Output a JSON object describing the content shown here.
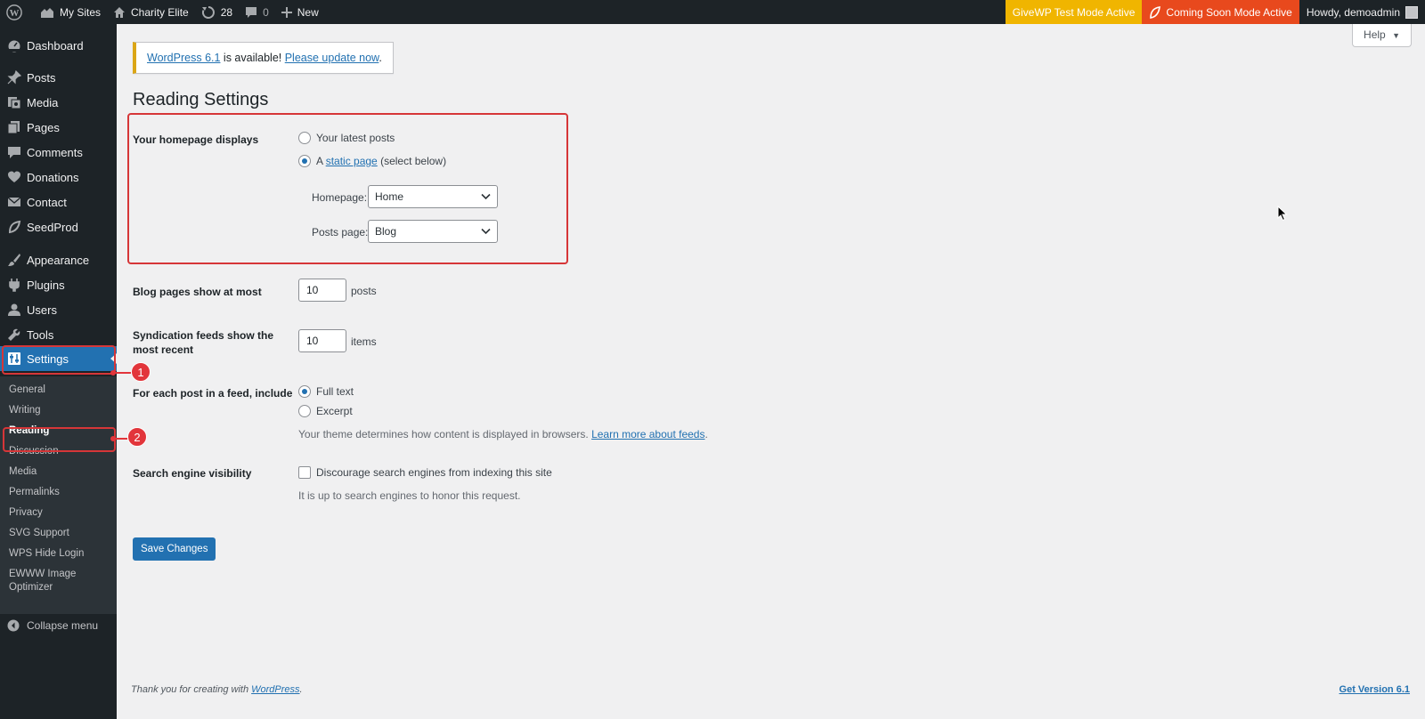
{
  "admin_bar": {
    "my_sites": "My Sites",
    "site_name": "Charity Elite",
    "updates_count": "28",
    "comments_count": "0",
    "new_label": "New",
    "givewp_notice": "GiveWP Test Mode Active",
    "coming_soon_notice": "Coming Soon Mode Active",
    "howdy": "Howdy, demoadmin",
    "colors": {
      "givewp": "#f0b500",
      "coming_soon": "#e8491d"
    }
  },
  "sidebar": {
    "items": [
      {
        "label": "Dashboard",
        "icon": "dashboard-icon"
      },
      {
        "label": "Posts",
        "icon": "pin-icon"
      },
      {
        "label": "Media",
        "icon": "media-icon"
      },
      {
        "label": "Pages",
        "icon": "pages-icon"
      },
      {
        "label": "Comments",
        "icon": "comment-icon"
      },
      {
        "label": "Donations",
        "icon": "heart-icon"
      },
      {
        "label": "Contact",
        "icon": "mail-icon"
      },
      {
        "label": "SeedProd",
        "icon": "seedprod-icon"
      },
      {
        "label": "Appearance",
        "icon": "brush-icon"
      },
      {
        "label": "Plugins",
        "icon": "plugin-icon"
      },
      {
        "label": "Users",
        "icon": "user-icon"
      },
      {
        "label": "Tools",
        "icon": "wrench-icon"
      },
      {
        "label": "Settings",
        "icon": "settings-icon"
      }
    ],
    "submenu": [
      "General",
      "Writing",
      "Reading",
      "Discussion",
      "Media",
      "Permalinks",
      "Privacy",
      "SVG Support",
      "WPS Hide Login",
      "EWWW Image",
      "Optimizer"
    ],
    "collapse": "Collapse menu",
    "active_submenu": "Reading"
  },
  "annotations": {
    "badge_1": "1",
    "badge_2": "2"
  },
  "help": "Help",
  "notice": {
    "link1": "WordPress 6.1",
    "text": " is available! ",
    "link2": "Please update now",
    "end": "."
  },
  "page_title": "Reading Settings",
  "homepage_displays": {
    "label": "Your homepage displays",
    "option_latest": "Your latest posts",
    "option_static_prefix": "A ",
    "option_static_link": "static page",
    "option_static_suffix": " (select below)",
    "selected": "static",
    "homepage_label": "Homepage:",
    "homepage_value": "Home",
    "posts_page_label": "Posts page:",
    "posts_page_value": "Blog"
  },
  "blog_pages": {
    "label": "Blog pages show at most",
    "value": "10",
    "unit": "posts"
  },
  "syndication": {
    "label_line1": "Syndication feeds show the",
    "label_line2": "most recent",
    "value": "10",
    "unit": "items"
  },
  "feed_include": {
    "label": "For each post in a feed, include",
    "option_full": "Full text",
    "option_excerpt": "Excerpt",
    "selected": "full",
    "desc_text": "Your theme determines how content is displayed in browsers. ",
    "desc_link": "Learn more about feeds",
    "desc_end": "."
  },
  "search_visibility": {
    "label": "Search engine visibility",
    "checkbox_label": "Discourage search engines from indexing this site",
    "checked": false,
    "desc": "It is up to search engines to honor this request."
  },
  "save_button": "Save Changes",
  "footer": {
    "thanks_text": "Thank you for creating with ",
    "thanks_link": "WordPress",
    "thanks_end": ".",
    "version_link": "Get Version 6.1"
  }
}
